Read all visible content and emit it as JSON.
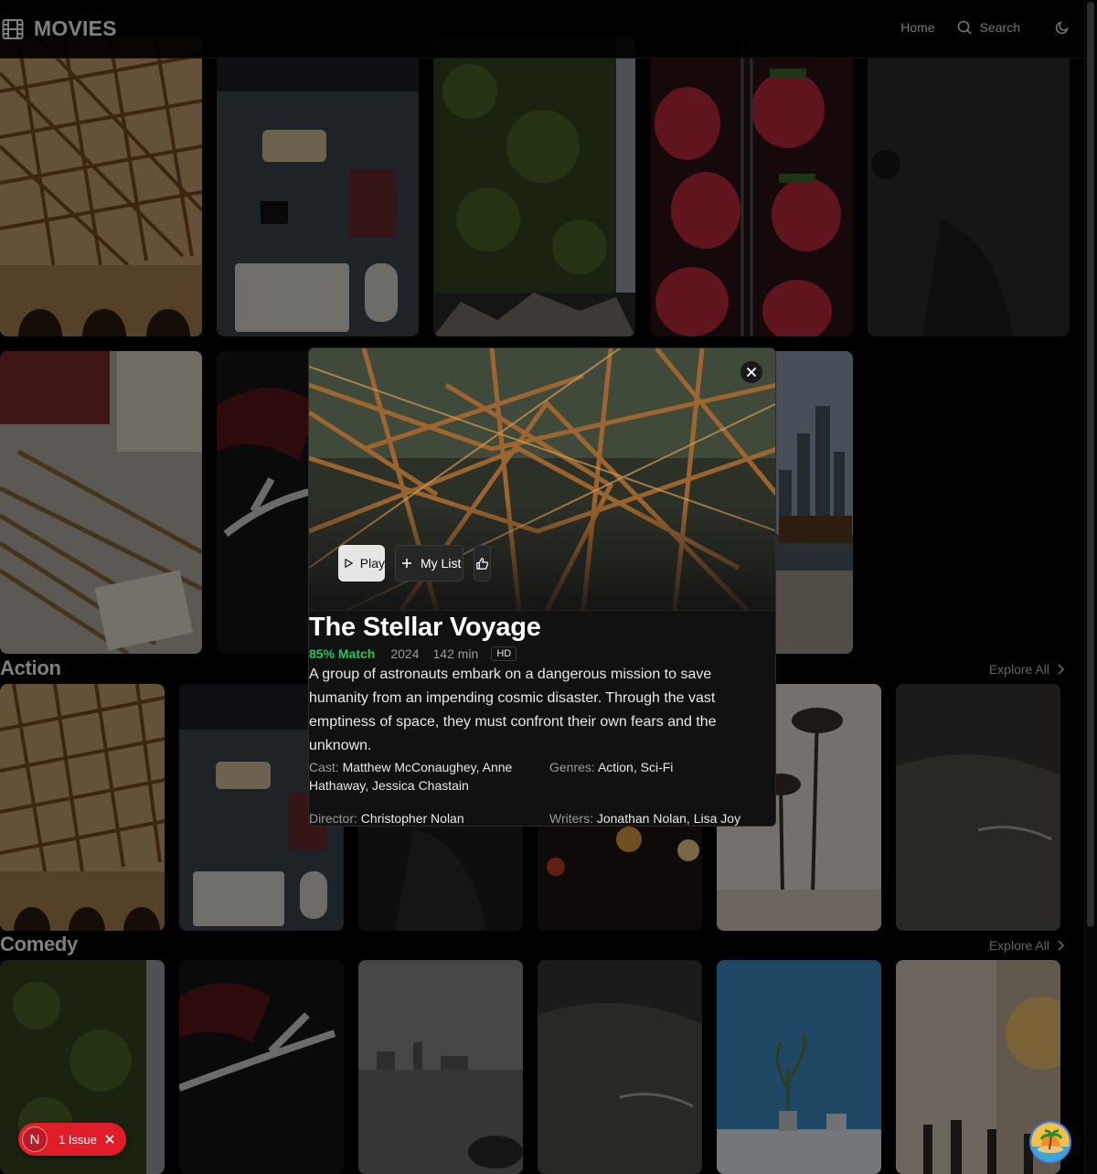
{
  "header": {
    "logo_text": "MOVIES",
    "nav_home": "Home",
    "nav_search": "Search"
  },
  "rows": [
    {
      "title": "Action",
      "explore_label": "Explore All"
    },
    {
      "title": "Comedy",
      "explore_label": "Explore All"
    }
  ],
  "modal": {
    "title": "The Stellar Voyage",
    "match": "85% Match",
    "year": "2024",
    "runtime": "142 min",
    "quality": "HD",
    "description": "A group of astronauts embark on a dangerous mission to save humanity from an impending cosmic disaster. Through the vast emptiness of space, they must confront their own fears and the unknown.",
    "cast_label": "Cast:",
    "cast": "Matthew McConaughey, Anne Hathaway, Jessica Chastain",
    "genres_label": "Genres:",
    "genres": "Action, Sci-Fi",
    "director_label": "Director:",
    "director": "Christopher Nolan",
    "writers_label": "Writers:",
    "writers": "Jonathan Nolan, Lisa Joy",
    "play_label": "Play",
    "mylist_label": "My List"
  },
  "issue_badge": {
    "initial": "N",
    "label": "1 Issue"
  },
  "colors": {
    "match_green": "#22c55e",
    "issue_red": "#e11d2a"
  },
  "icons": [
    "film-icon",
    "search-icon",
    "moon-icon",
    "close-icon",
    "play-icon",
    "plus-icon",
    "thumbs-up-icon",
    "chevron-right-icon"
  ]
}
